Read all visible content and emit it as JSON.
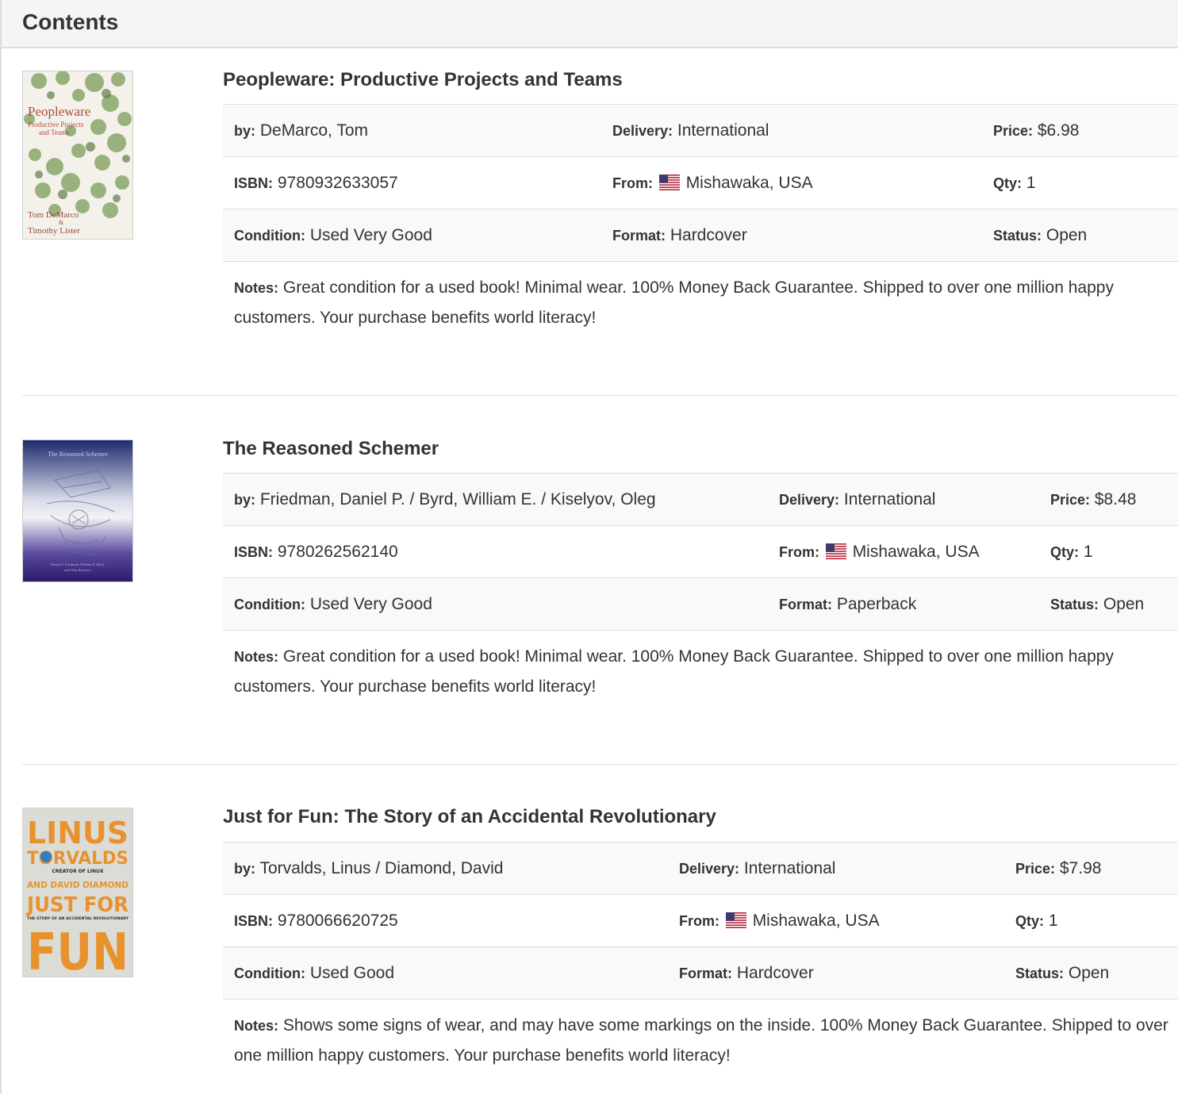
{
  "panel": {
    "title": "Contents"
  },
  "labels": {
    "by": "by:",
    "delivery": "Delivery:",
    "price": "Price:",
    "isbn": "ISBN:",
    "from": "From:",
    "qty": "Qty:",
    "condition": "Condition:",
    "format": "Format:",
    "status": "Status:",
    "notes": "Notes:"
  },
  "books": [
    {
      "title": "Peopleware: Productive Projects and Teams",
      "author": "DeMarco, Tom",
      "delivery": "International",
      "price": "$6.98",
      "isbn": "9780932633057",
      "from": "Mishawaka, USA",
      "flag": "us-flag-icon",
      "qty": "1",
      "condition": "Used Very Good",
      "format": "Hardcover",
      "status": "Open",
      "notes": "Great condition for a used book! Minimal wear. 100% Money Back Guarantee. Shipped to over one million happy customers. Your purchase benefits world literacy!",
      "cover": {
        "title_line": "Peopleware",
        "subtitle_lines": [
          "Productive Projects",
          "and Teams"
        ],
        "author_lines": [
          "Tom DeMarco",
          "&",
          "Timothy Lister"
        ],
        "colors": {
          "background": "#f3f1ea",
          "foliage": "#8aa86a",
          "text": "#b04a3a"
        }
      }
    },
    {
      "title": "The Reasoned Schemer",
      "author": "Friedman, Daniel P. / Byrd, William E. / Kiselyov, Oleg",
      "delivery": "International",
      "price": "$8.48",
      "isbn": "9780262562140",
      "from": "Mishawaka, USA",
      "flag": "us-flag-icon",
      "qty": "1",
      "condition": "Used Very Good",
      "format": "Paperback",
      "status": "Open",
      "notes": "Great condition for a used book! Minimal wear. 100% Money Back Guarantee. Shipped to over one million happy customers. Your purchase benefits world literacy!",
      "cover": {
        "title_line": "The Reasoned Schemer",
        "author_lines": [
          "Daniel P. Friedman, William E. Byrd,",
          "and Oleg Kiselyov"
        ],
        "colors": {
          "top": "#1c2a6e",
          "middle": "#f2f2f5",
          "bottom": "#2d1a6a"
        }
      }
    },
    {
      "title": "Just for Fun: The Story of an Accidental Revolutionary",
      "author": "Torvalds, Linus / Diamond, David",
      "delivery": "International",
      "price": "$7.98",
      "isbn": "9780066620725",
      "from": "Mishawaka, USA",
      "flag": "us-flag-icon",
      "qty": "1",
      "condition": "Used Good",
      "format": "Hardcover",
      "status": "Open",
      "notes": "Shows some signs of wear, and may have some markings on the inside. 100% Money Back Guarantee. Shipped to over one million happy customers. Your purchase benefits world literacy!",
      "cover": {
        "lines": [
          "LINUS",
          "TORVALDS",
          "CREATOR OF LINUX",
          "AND DAVID DIAMOND",
          "JUST FOR",
          "THE STORY OF AN ACCIDENTAL REVOLUTIONARY",
          "FUN"
        ],
        "colors": {
          "background": "#dcdcd6",
          "orange": "#e8922e",
          "dark": "#2b2b2b",
          "blue": "#2f7fc1"
        }
      }
    }
  ]
}
